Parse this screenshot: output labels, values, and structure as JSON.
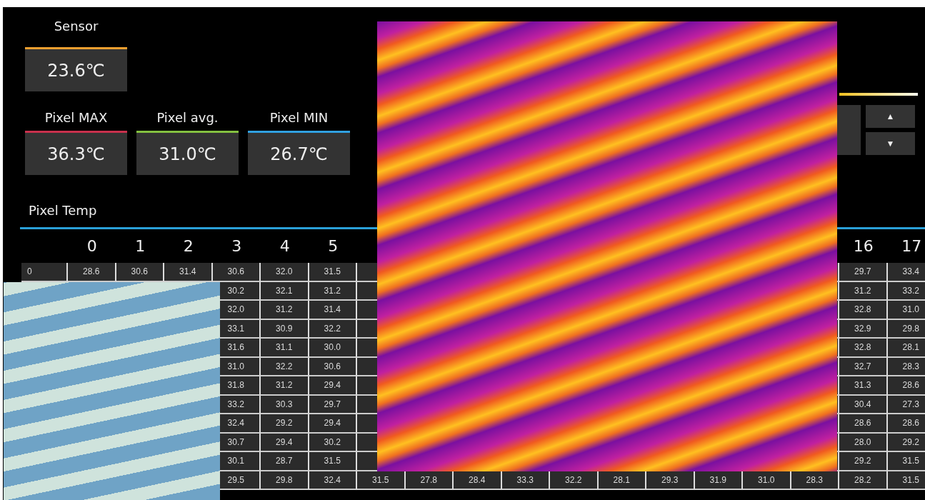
{
  "sensor": {
    "label": "Sensor",
    "value": "23.6℃",
    "color": "#f0a030"
  },
  "pixel_stats": [
    {
      "label": "Pixel MAX",
      "value": "36.3℃",
      "color": "#c8304c"
    },
    {
      "label": "Pixel avg.",
      "value": "31.0℃",
      "color": "#84c040"
    },
    {
      "label": "Pixel MIN",
      "value": "26.7℃",
      "color": "#30a0e0"
    }
  ],
  "side_control": {
    "buttons": [
      "▲",
      "▼"
    ]
  },
  "pixel_temp": {
    "title": "Pixel Temp",
    "columns": [
      "0",
      "1",
      "2",
      "3",
      "4",
      "5",
      null,
      null,
      null,
      null,
      null,
      null,
      null,
      null,
      null,
      null,
      "16",
      "17"
    ],
    "rows": [
      {
        "label": "0",
        "cells": [
          "28.6",
          "30.6",
          "31.4",
          "30.6",
          "32.0",
          "31.5",
          null,
          null,
          null,
          null,
          null,
          null,
          null,
          null,
          null,
          null,
          "29.7",
          "33.4"
        ]
      },
      {
        "label": null,
        "cells": [
          null,
          null,
          null,
          "30.2",
          "32.1",
          "31.2",
          null,
          null,
          null,
          null,
          null,
          null,
          null,
          null,
          null,
          null,
          "31.2",
          "33.2"
        ]
      },
      {
        "label": null,
        "cells": [
          null,
          null,
          null,
          "32.0",
          "31.2",
          "31.4",
          null,
          null,
          null,
          null,
          null,
          null,
          null,
          null,
          null,
          null,
          "32.8",
          "31.0"
        ]
      },
      {
        "label": null,
        "cells": [
          null,
          null,
          null,
          "33.1",
          "30.9",
          "32.2",
          null,
          null,
          null,
          null,
          null,
          null,
          null,
          null,
          null,
          null,
          "32.9",
          "29.8"
        ]
      },
      {
        "label": null,
        "cells": [
          null,
          null,
          null,
          "31.6",
          "31.1",
          "30.0",
          null,
          null,
          null,
          null,
          null,
          null,
          null,
          null,
          null,
          null,
          "32.8",
          "28.1"
        ]
      },
      {
        "label": null,
        "cells": [
          null,
          null,
          null,
          "31.0",
          "32.2",
          "30.6",
          null,
          null,
          null,
          null,
          null,
          null,
          null,
          null,
          null,
          null,
          "32.7",
          "28.3"
        ]
      },
      {
        "label": null,
        "cells": [
          null,
          null,
          null,
          "31.8",
          "31.2",
          "29.4",
          null,
          null,
          null,
          null,
          null,
          null,
          null,
          null,
          null,
          null,
          "31.3",
          "28.6"
        ]
      },
      {
        "label": null,
        "cells": [
          null,
          null,
          null,
          "33.2",
          "30.3",
          "29.7",
          null,
          null,
          null,
          null,
          null,
          null,
          null,
          null,
          null,
          null,
          "30.4",
          "27.3"
        ]
      },
      {
        "label": null,
        "cells": [
          null,
          null,
          null,
          "32.4",
          "29.2",
          "29.4",
          null,
          null,
          null,
          null,
          null,
          null,
          null,
          null,
          null,
          null,
          "28.6",
          "28.6"
        ]
      },
      {
        "label": null,
        "cells": [
          null,
          null,
          null,
          "30.7",
          "29.4",
          "30.2",
          null,
          null,
          null,
          null,
          null,
          null,
          null,
          null,
          null,
          null,
          "28.0",
          "29.2"
        ]
      },
      {
        "label": null,
        "cells": [
          null,
          null,
          null,
          "30.1",
          "28.7",
          "31.5",
          null,
          null,
          null,
          null,
          null,
          null,
          null,
          null,
          null,
          null,
          "29.2",
          "31.5"
        ]
      },
      {
        "label": null,
        "cells": [
          null,
          null,
          null,
          "29.5",
          "29.8",
          "32.4",
          "31.5",
          "27.8",
          "28.4",
          "33.3",
          "32.2",
          "28.1",
          "29.3",
          "31.9",
          "31.0",
          "28.3",
          "28.2",
          "31.5"
        ]
      }
    ]
  }
}
